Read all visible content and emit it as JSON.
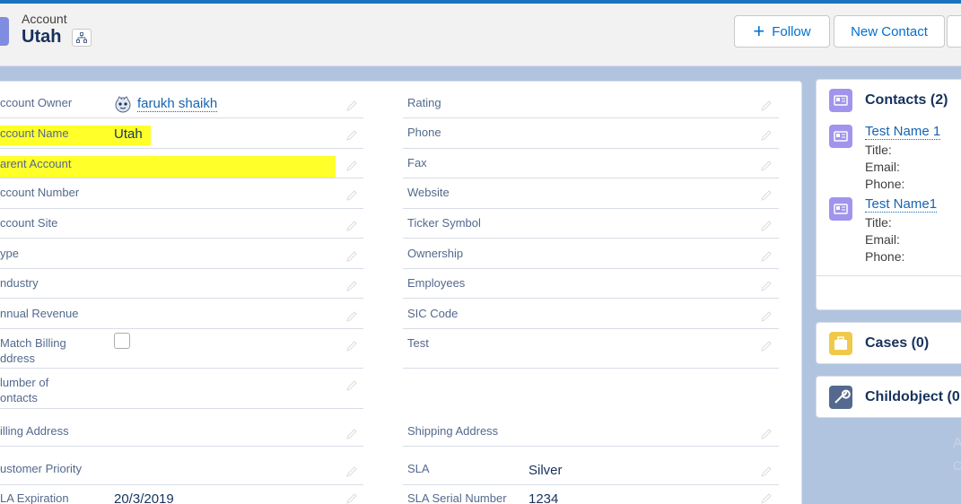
{
  "header": {
    "object_label": "Account",
    "title": "Utah",
    "buttons": {
      "follow": "Follow",
      "new_contact": "New Contact"
    }
  },
  "fields_left": [
    {
      "label": "Account Owner",
      "value": "farukh shaikh"
    },
    {
      "label": "Account Name",
      "value": "Utah"
    },
    {
      "label": "Parent Account",
      "value": ""
    },
    {
      "label": "Account Number",
      "value": ""
    },
    {
      "label": "Account Site",
      "value": ""
    },
    {
      "label": "Type",
      "value": ""
    },
    {
      "label": "Industry",
      "value": ""
    },
    {
      "label": "Annual Revenue",
      "value": ""
    },
    {
      "label": "Match Billing Address",
      "value": ""
    },
    {
      "label": "Number of Contacts",
      "value": ""
    },
    {
      "label": "Billing Address",
      "value": ""
    },
    {
      "label": "Customer Priority",
      "value": ""
    },
    {
      "label": "SLA Expiration",
      "value": "20/3/2019"
    }
  ],
  "visible_left_labels": [
    "ccount Owner",
    "ccount Name",
    "arent Account",
    "ccount Number",
    "ccount Site",
    "ype",
    "ndustry",
    "nnual Revenue",
    "Match Billing",
    "ddress",
    "lumber of",
    "ontacts",
    "illing Address",
    "ustomer Priority",
    "LA Expiration"
  ],
  "fields_right": [
    {
      "label": "Rating",
      "value": ""
    },
    {
      "label": "Phone",
      "value": ""
    },
    {
      "label": "Fax",
      "value": ""
    },
    {
      "label": "Website",
      "value": ""
    },
    {
      "label": "Ticker Symbol",
      "value": ""
    },
    {
      "label": "Ownership",
      "value": ""
    },
    {
      "label": "Employees",
      "value": ""
    },
    {
      "label": "SIC Code",
      "value": ""
    },
    {
      "label": "Test",
      "value": ""
    },
    {
      "label": "Shipping Address",
      "value": ""
    },
    {
      "label": "SLA",
      "value": "Silver"
    },
    {
      "label": "SLA Serial Number",
      "value": "1234"
    }
  ],
  "contacts_card": {
    "title": "Contacts (2)",
    "contacts": [
      {
        "name": "Test Name 1",
        "title_label": "Title:",
        "email_label": "Email:",
        "phone_label": "Phone:"
      },
      {
        "name": "Test Name1",
        "title_label": "Title:",
        "email_label": "Email:",
        "phone_label": "Phone:"
      }
    ]
  },
  "cases_card": {
    "title": "Cases (0)"
  },
  "childobject_card": {
    "title": "Childobject (0"
  },
  "faint_text": [
    "A",
    "C"
  ],
  "colors": {
    "brand_blue": "#1b74c0",
    "highlight_yellow": "#ffff2a",
    "contact_icon": "#a094ed",
    "cases_icon": "#f0c94b",
    "childobject_icon": "#54698d",
    "link": "#1664b0"
  },
  "icons": {
    "header": "account-icon",
    "hierarchy": "hierarchy-icon",
    "follow": "plus-icon",
    "owner": "user-avatar-icon",
    "edit": "pencil-icon",
    "contacts": "contact-card-icon",
    "cases": "briefcase-icon",
    "childobject": "wrench-icon"
  }
}
